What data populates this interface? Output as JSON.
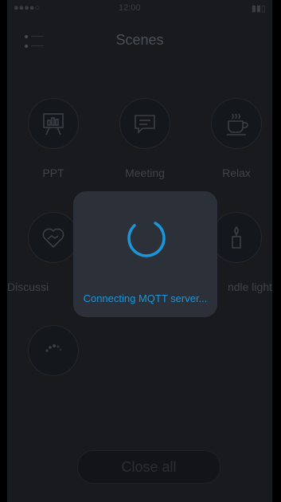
{
  "status_bar": {
    "carrier": "●●●●○ ",
    "time": "12:00",
    "battery": "▮▮▯"
  },
  "header": {
    "title": "Scenes",
    "menu_icon": "menu-list-icon"
  },
  "scenes": [
    {
      "label": "PPT",
      "icon": "presentation-icon"
    },
    {
      "label": "Meeting",
      "icon": "chat-bubble-icon"
    },
    {
      "label": "Relax",
      "icon": "coffee-cup-icon"
    },
    {
      "label": "Discussi",
      "icon": "heart-handshake-icon"
    },
    {
      "label": "ndle light",
      "icon": "candle-icon"
    },
    {
      "label": "",
      "icon": "dots-icon"
    }
  ],
  "footer": {
    "close_all_label": "Close all"
  },
  "loading_dialog": {
    "message": "Connecting MQTT server..."
  },
  "colors": {
    "accent": "#1e95d8",
    "background": "#181a1d",
    "dialog": "#2c3038"
  }
}
